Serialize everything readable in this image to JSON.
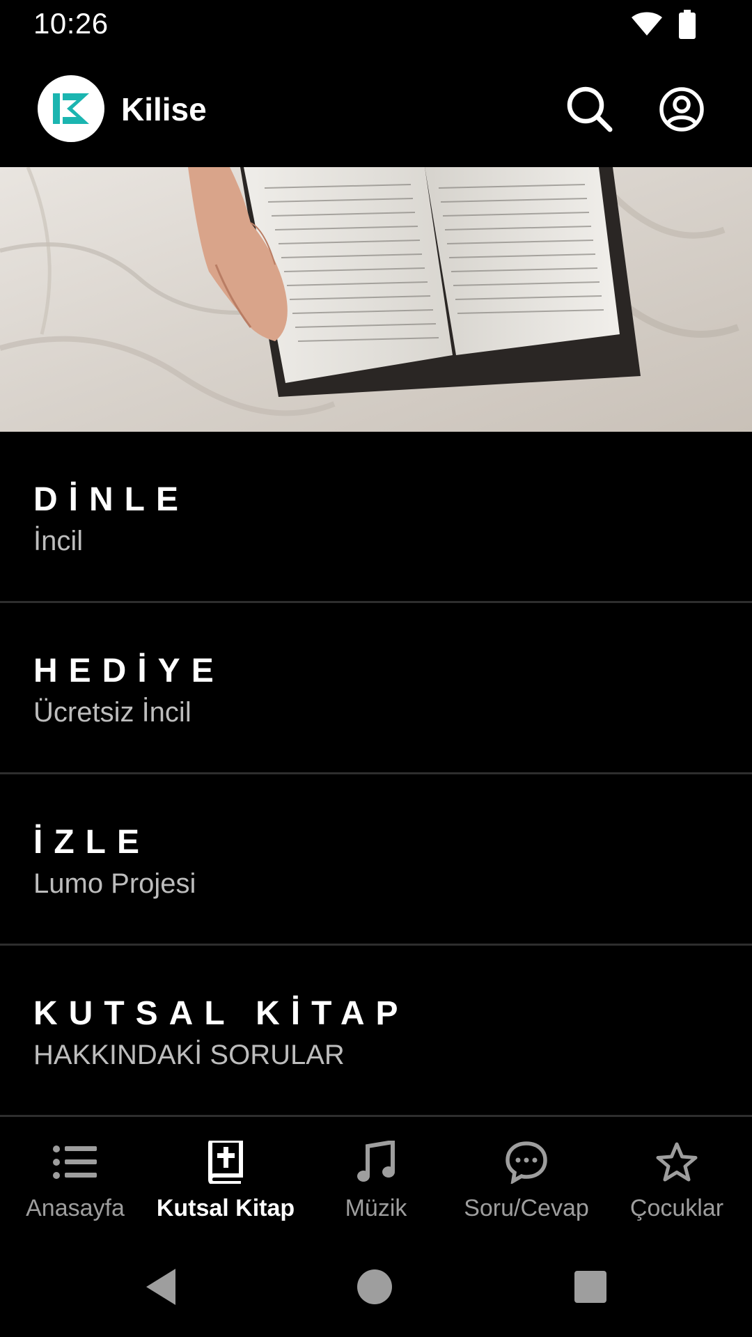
{
  "status_bar": {
    "time": "10:26"
  },
  "app_bar": {
    "title": "Kilise"
  },
  "menu": [
    {
      "title": "DİNLE",
      "subtitle": "İncil"
    },
    {
      "title": "HEDİYE",
      "subtitle": "Ücretsiz İncil"
    },
    {
      "title": "İZLE",
      "subtitle": "Lumo Projesi"
    },
    {
      "title": "KUTSAL KİTAP",
      "subtitle": "HAKKINDAKİ SORULAR"
    }
  ],
  "bottom_nav": [
    {
      "label": "Anasayfa",
      "icon": "list-icon",
      "active": false
    },
    {
      "label": "Kutsal Kitap",
      "icon": "bible-icon",
      "active": true
    },
    {
      "label": "Müzik",
      "icon": "music-note-icon",
      "active": false
    },
    {
      "label": "Soru/Cevap",
      "icon": "chat-bubble-icon",
      "active": false
    },
    {
      "label": "Çocuklar",
      "icon": "star-icon",
      "active": false
    }
  ],
  "colors": {
    "background": "#000000",
    "accent": "#1bb5b0",
    "inactive": "#9e9e9e"
  }
}
